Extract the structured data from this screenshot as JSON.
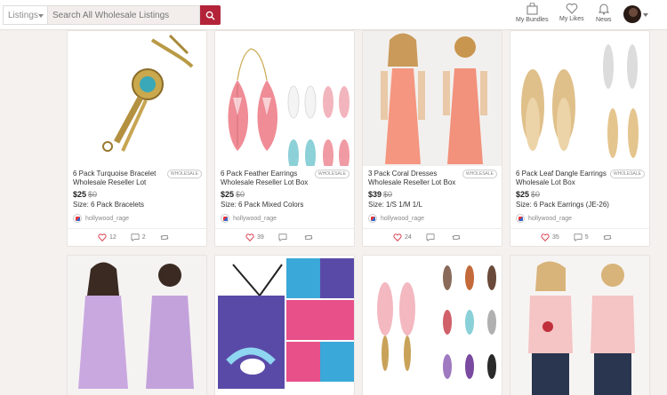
{
  "header": {
    "category_label": "Listings",
    "search_placeholder": "Search All Wholesale Listings",
    "nav": {
      "bundles": "My Bundles",
      "likes": "My Likes",
      "news": "News"
    }
  },
  "products": [
    {
      "title": "6 Pack Turquoise Bracelet Wholesale Reseller Lot",
      "badge": "WHOLESALE",
      "price": "$25",
      "old_price": "$0",
      "size": "Size: 6 Pack Bracelets",
      "seller": "hollywood_rage",
      "likes": "12",
      "comments": "2",
      "shares": ""
    },
    {
      "title": "6 Pack Feather Earrings Wholesale Reseller Lot Box",
      "badge": "WHOLESALE",
      "price": "$25",
      "old_price": "$0",
      "size": "Size: 6 Pack Mixed Colors",
      "seller": "hollywood_rage",
      "likes": "39",
      "comments": "",
      "shares": ""
    },
    {
      "title": "3 Pack Coral Dresses Wholesale Reseller Lot Box",
      "badge": "WHOLESALE",
      "price": "$39",
      "old_price": "$0",
      "size": "Size: 1/S 1/M 1/L",
      "seller": "hollywood_rage",
      "likes": "24",
      "comments": "",
      "shares": ""
    },
    {
      "title": "6 Pack Leaf Dangle Earrings Wholesale Lot Box",
      "badge": "WHOLESALE",
      "price": "$25",
      "old_price": "$0",
      "size": "Size: 6 Pack Earrings (JE-26)",
      "seller": "hollywood_rage",
      "likes": "35",
      "comments": "5",
      "shares": ""
    }
  ],
  "colors": {
    "accent": "#b3243a",
    "like": "#d9364a"
  }
}
